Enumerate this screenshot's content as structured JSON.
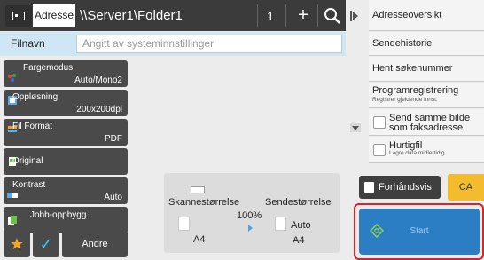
{
  "address_bar": {
    "tab_label": "Adresse",
    "path": "\\\\Server1\\Folder1",
    "count": "1",
    "plus_label": "+",
    "icons": [
      "address-book-icon",
      "search-icon"
    ]
  },
  "filename": {
    "label": "Filnavn",
    "placeholder": "Angitt av systeminnstillinger"
  },
  "left_menu": [
    {
      "label": "Fargemodus",
      "value": "Auto/Mono2",
      "icon": "color-mode-icon"
    },
    {
      "label": "Oppløsning",
      "value": "200x200dpi",
      "icon": "resolution-icon"
    },
    {
      "label": "Fil Format",
      "value": "PDF",
      "icon": "file-format-icon"
    },
    {
      "label": "Original",
      "value": "",
      "icon": "original-icon"
    },
    {
      "label": "Kontrast",
      "value": "Auto",
      "icon": "contrast-icon"
    },
    {
      "label": "Jobb-oppbygg.",
      "value": "",
      "icon": "job-build-icon"
    }
  ],
  "bottom_left": {
    "star": "★",
    "check": "✓",
    "other_label": "Andre"
  },
  "size_panel": {
    "scan_label": "Skannestørrelse",
    "send_label": "Sendestørrelse",
    "ratio": "100%",
    "send_auto": "Auto",
    "scan_size": "A4",
    "send_size": "A4"
  },
  "right_panel": {
    "address_overview": "Adresseoversikt",
    "send_history": "Sendehistorie",
    "get_search_number": "Hent søkenummer",
    "program_registration": "Programregistrering",
    "program_registration_sub": "Registrer gjeldende innst.",
    "send_same_fax": "Send samme bilde som faksadresse",
    "quick_file": "Hurtigfil",
    "quick_file_sub": "Lagre data midlertidig"
  },
  "actions": {
    "preview": "Forhåndsvis",
    "ca": "CA",
    "start": "Start"
  },
  "colors": {
    "dark_button": "#4a4a4a",
    "filename_bar": "#cfe6f4",
    "start_blue": "#2c7ec4",
    "highlight_red": "#e0202b",
    "ca_yellow": "#f3bc2f"
  }
}
